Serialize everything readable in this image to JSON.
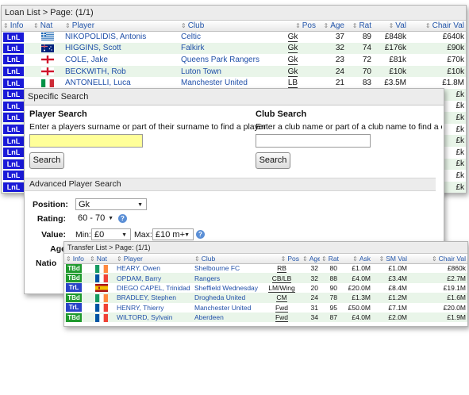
{
  "loan_list": {
    "title": "Loan List > Page: (1/1)",
    "columns": [
      "Info",
      "Nat",
      "Player",
      "Club",
      "Pos",
      "Age",
      "Rat",
      "Val",
      "Chair Val"
    ],
    "rows": [
      {
        "info": "LnL",
        "nat": "Greece",
        "player": "NIKOPOLIDIS, Antonis",
        "club": "Celtic",
        "pos": "Gk",
        "age": "37",
        "rat": "89",
        "val": "£848k",
        "chair": "£640k"
      },
      {
        "info": "LnL",
        "nat": "Australia",
        "player": "HIGGINS, Scott",
        "club": "Falkirk",
        "pos": "Gk",
        "age": "32",
        "rat": "74",
        "val": "£176k",
        "chair": "£90k"
      },
      {
        "info": "LnL",
        "nat": "England",
        "player": "COLE, Jake",
        "club": "Queens Park Rangers",
        "pos": "Gk",
        "age": "23",
        "rat": "72",
        "val": "£81k",
        "chair": "£70k"
      },
      {
        "info": "LnL",
        "nat": "England",
        "player": "BECKWITH, Rob",
        "club": "Luton Town",
        "pos": "Gk",
        "age": "24",
        "rat": "70",
        "val": "£10k",
        "chair": "£10k"
      },
      {
        "info": "LnL",
        "nat": "Italy",
        "player": "ANTONELLI, Luca",
        "club": "Manchester United",
        "pos": "LB",
        "age": "21",
        "rat": "83",
        "val": "£3.5M",
        "chair": "£1.8M"
      }
    ],
    "partial_chair_vals": [
      "£k",
      "£k",
      "£k",
      "£k",
      "£k",
      "£k",
      "£k",
      "£k",
      "£k",
      "£k"
    ]
  },
  "search": {
    "title": "Specific Search",
    "player_heading": "Player Search",
    "player_desc": "Enter a players surname or part of their surname to find a player",
    "player_value": "",
    "club_heading": "Club Search",
    "club_desc": "Enter a club name or part of a club name to find a club",
    "club_value": "",
    "search_label": "Search",
    "advanced_title": "Advanced Player Search",
    "position_label": "Position:",
    "position_value": "Gk",
    "rating_label": "Rating:",
    "rating_value": "60 - 70",
    "value_label": "Value:",
    "min_label": "Min:",
    "min_value": "£0",
    "max_label": "Max:",
    "max_value": "£10 m+",
    "age_label": "Age",
    "nation_label": "Natio"
  },
  "transfer_list": {
    "title": "Transfer List > Page: (1/1)",
    "columns": [
      "Info",
      "Nat",
      "Player",
      "Club",
      "Pos",
      "Age",
      "Rat",
      "Ask",
      "SM Val",
      "Chair Val"
    ],
    "rows": [
      {
        "info": "TBd",
        "nat": "Ireland",
        "player": "HEARY, Owen",
        "club": "Shelbourne FC",
        "pos": "RB",
        "age": "32",
        "rat": "80",
        "ask": "£1.0M",
        "sm": "£1.0M",
        "chair": "£860k"
      },
      {
        "info": "TBd",
        "nat": "France",
        "player": "OPDAM, Barry",
        "club": "Rangers",
        "pos": "CB/LB",
        "age": "32",
        "rat": "88",
        "ask": "£4.0M",
        "sm": "£3.4M",
        "chair": "£2.7M"
      },
      {
        "info": "TrL",
        "nat": "Spain",
        "player": "DIEGO CAPEL, Trinidad",
        "club": "Sheffield Wednesday",
        "pos": "LM/Wing",
        "age": "20",
        "rat": "90",
        "ask": "£20.0M",
        "sm": "£8.4M",
        "chair": "£19.1M"
      },
      {
        "info": "TBd",
        "nat": "Ireland",
        "player": "BRADLEY, Stephen",
        "club": "Drogheda United",
        "pos": "CM",
        "age": "24",
        "rat": "78",
        "ask": "£1.3M",
        "sm": "£1.2M",
        "chair": "£1.6M"
      },
      {
        "info": "TrL",
        "nat": "France",
        "player": "HENRY, Thierry",
        "club": "Manchester United",
        "pos": "Fwd",
        "age": "31",
        "rat": "95",
        "ask": "£50.0M",
        "sm": "£7.1M",
        "chair": "£20.0M"
      },
      {
        "info": "TBd",
        "nat": "France",
        "player": "WILTORD, Sylvain",
        "club": "Aberdeen",
        "pos": "Fwd",
        "age": "34",
        "rat": "87",
        "ask": "£4.0M",
        "sm": "£2.0M",
        "chair": "£1.9M"
      }
    ]
  },
  "colors": {
    "lnl_badge": "#1a1ad8",
    "tbd_badge": "#1f9a2e",
    "trl_badge": "#2a44c8",
    "link": "#1f4fa8",
    "highlight_input": "#ffff99"
  }
}
